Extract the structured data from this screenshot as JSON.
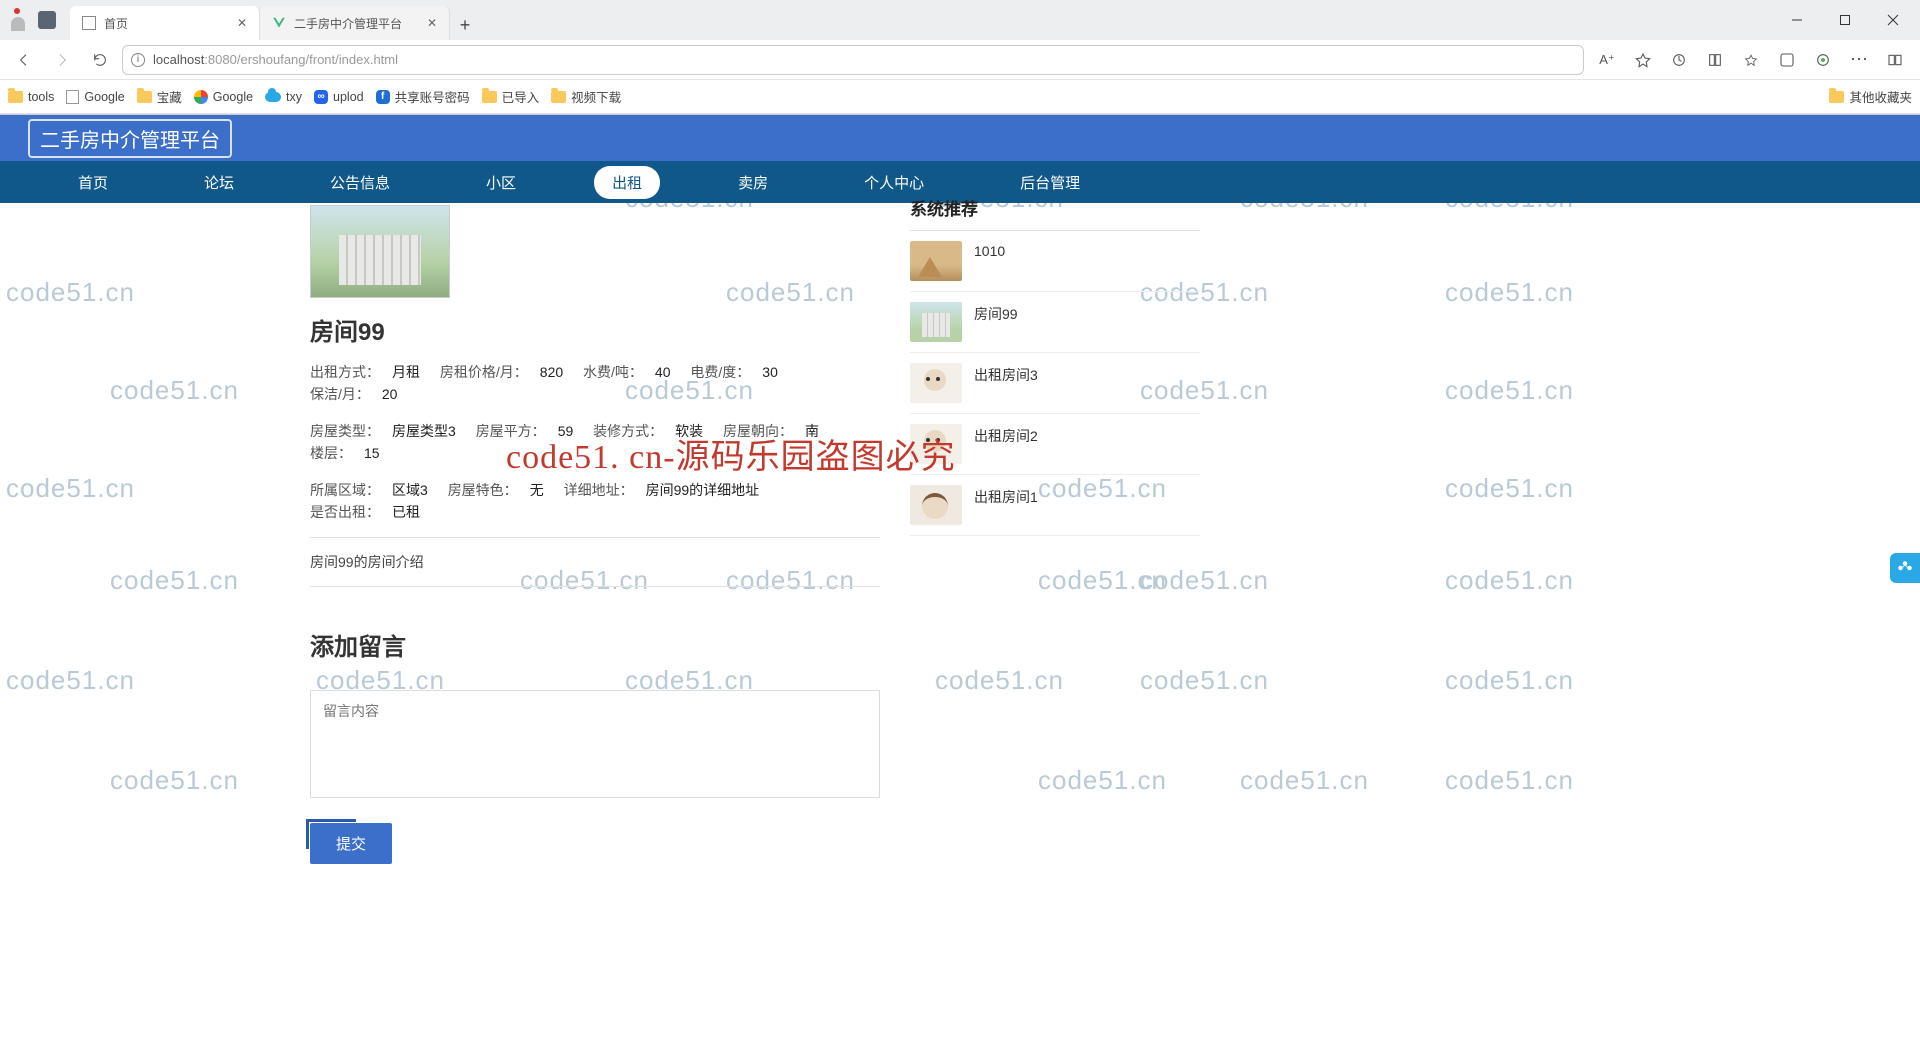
{
  "browser": {
    "tabs": [
      {
        "title": "首页",
        "active": true
      },
      {
        "title": "二手房中介管理平台",
        "active": false
      }
    ],
    "url_host": "localhost",
    "url_port": ":8080",
    "url_path": "/ershoufang/front/index.html",
    "zoom_label": "A⁺",
    "bookmarks": [
      "tools",
      "Google",
      "宝藏",
      "Google",
      "txy",
      "uplod",
      "共享账号密码",
      "已导入",
      "视频下载"
    ],
    "bookmark_right": "其他收藏夹"
  },
  "app": {
    "title": "二手房中介管理平台",
    "nav": [
      "首页",
      "论坛",
      "公告信息",
      "小区",
      "出租",
      "卖房",
      "个人中心",
      "后台管理"
    ],
    "active_nav_index": 4
  },
  "property": {
    "title": "房间99",
    "specs": {
      "rent_type_label": "出租方式：",
      "rent_type": "月租",
      "price_label": "房租价格/月：",
      "price": "820",
      "water_label": "水费/吨：",
      "water": "40",
      "elec_label": "电费/度：",
      "elec": "30",
      "clean_label": "保洁/月：",
      "clean": "20",
      "house_type_label": "房屋类型：",
      "house_type": "房屋类型3",
      "area_label": "房屋平方：",
      "area": "59",
      "deco_label": "装修方式：",
      "deco": "软装",
      "orient_label": "房屋朝向：",
      "orient": "南",
      "floor_label": "楼层：",
      "floor": "15",
      "region_label": "所属区域：",
      "region": "区域3",
      "feature_label": "房屋特色：",
      "feature": "无",
      "addr_label": "详细地址：",
      "addr": "房间99的详细地址",
      "rented_label": "是否出租：",
      "rented": "已租"
    },
    "description": "房间99的房间介绍"
  },
  "comment": {
    "heading": "添加留言",
    "placeholder": "留言内容",
    "submit": "提交"
  },
  "side": {
    "heading": "系统推荐",
    "items": [
      {
        "title": "1010",
        "thumb": "pyramid"
      },
      {
        "title": "房间99",
        "thumb": "apt"
      },
      {
        "title": "出租房间3",
        "thumb": "dog"
      },
      {
        "title": "出租房间2",
        "thumb": "dog"
      },
      {
        "title": "出租房间1",
        "thumb": "cat"
      }
    ]
  },
  "watermark_text": "code51.cn",
  "central_watermark": "code51. cn-源码乐园盗图必究"
}
